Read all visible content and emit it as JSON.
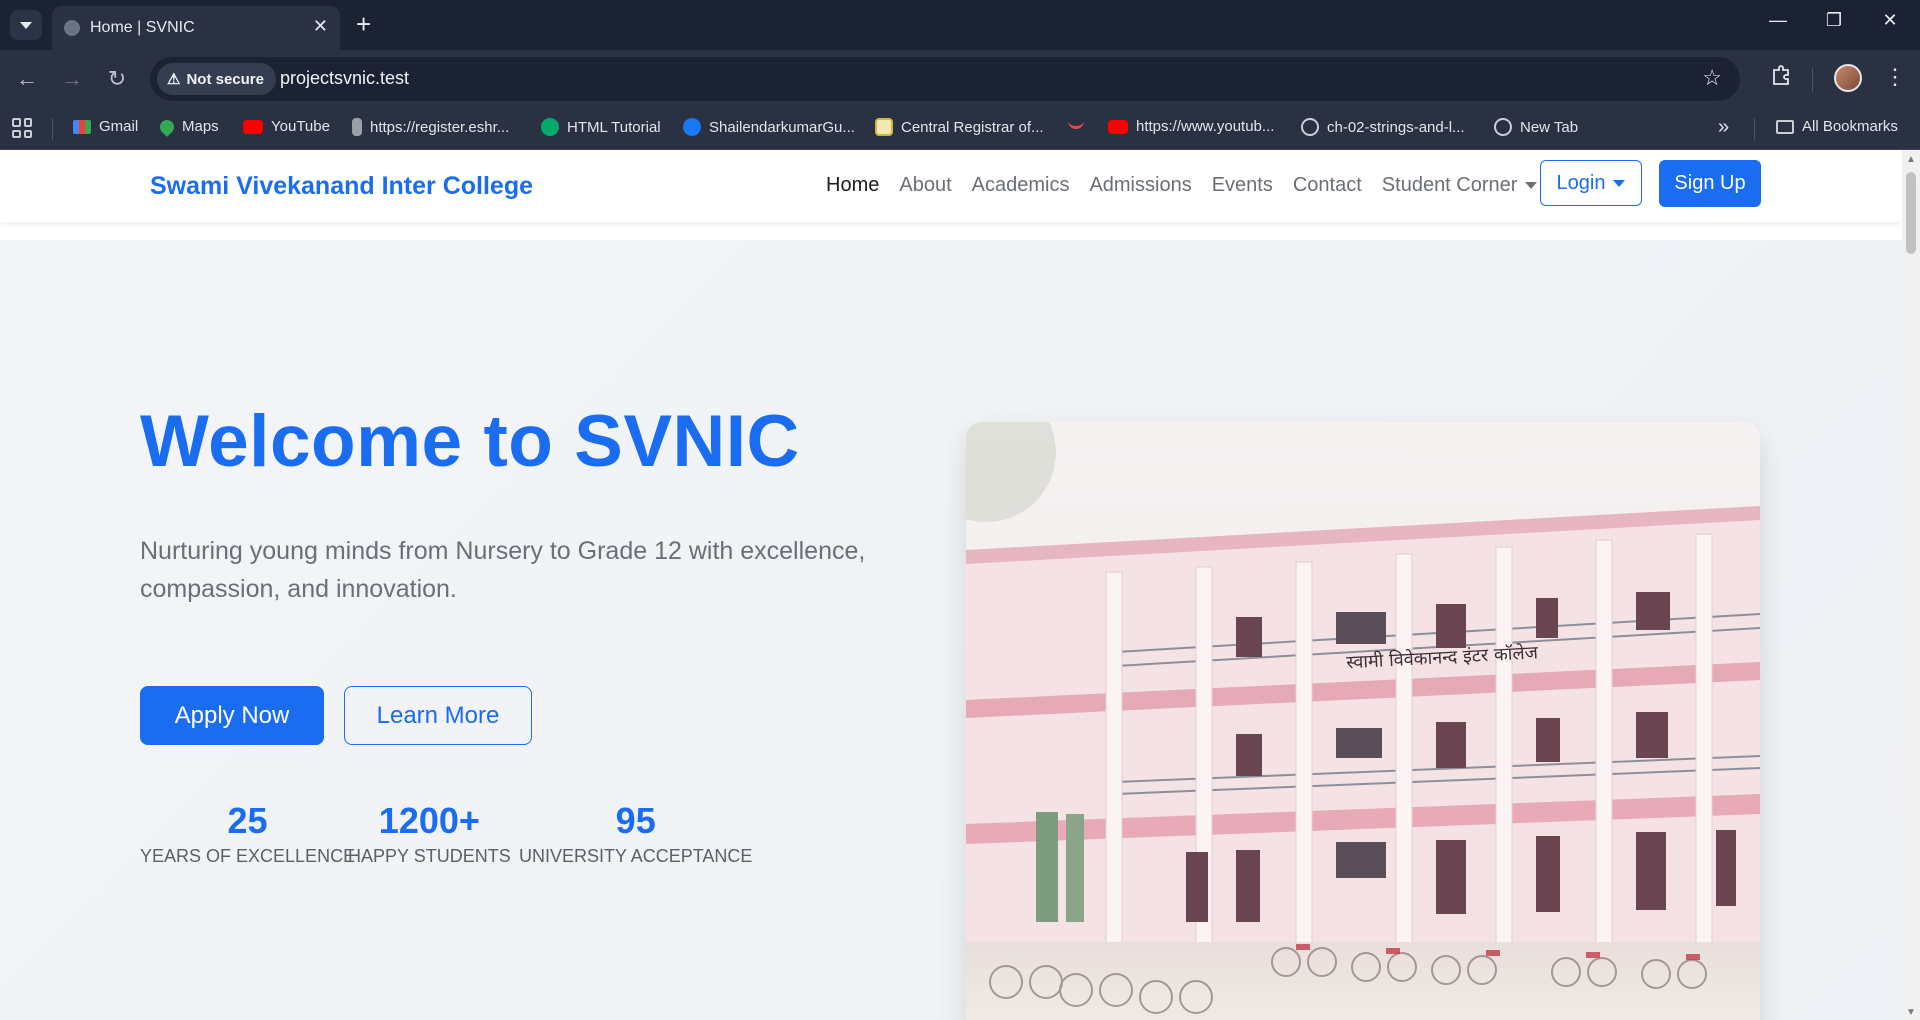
{
  "browser": {
    "tab_title": "Home | SVNIC",
    "security_label": "Not secure",
    "url": "projectsvnic.test",
    "bookmarks": [
      {
        "label": "Gmail",
        "icon": "gmail-icon",
        "color": "#ea4335"
      },
      {
        "label": "Maps",
        "icon": "maps-icon",
        "color": "#34a853"
      },
      {
        "label": "YouTube",
        "icon": "youtube-icon",
        "color": "#ff0000"
      },
      {
        "label": "https://register.eshr...",
        "icon": "emblem-icon",
        "color": "#9aa0a6"
      },
      {
        "label": "HTML Tutorial",
        "icon": "w3-icon",
        "color": "#04aa6d"
      },
      {
        "label": "ShailendarkumarGu...",
        "icon": "facebook-icon",
        "color": "#1877f2"
      },
      {
        "label": "Central Registrar of...",
        "icon": "seal-icon",
        "color": "#d4b43c"
      },
      {
        "label": "",
        "icon": "smile-icon",
        "color": "#e5484d"
      },
      {
        "label": "https://www.youtub...",
        "icon": "youtube-icon",
        "color": "#ff0000"
      },
      {
        "label": "ch-02-strings-and-l...",
        "icon": "globe-icon",
        "color": "#9aa0a6"
      },
      {
        "label": "New Tab",
        "icon": "globe-icon",
        "color": "#9aa0a6"
      }
    ],
    "all_bookmarks_label": "All Bookmarks"
  },
  "site": {
    "brand": "Swami Vivekanand Inter College",
    "nav": {
      "home": "Home",
      "about": "About",
      "academics": "Academics",
      "admissions": "Admissions",
      "events": "Events",
      "contact": "Contact",
      "student_corner": "Student Corner"
    },
    "login_label": "Login",
    "signup_label": "Sign Up",
    "accent_color": "#1a6cf0"
  },
  "hero": {
    "title": "Welcome to SVNIC",
    "subtitle": "Nurturing young minds from Nursery to Grade 12 with excellence, compassion, and innovation.",
    "apply_label": "Apply Now",
    "learn_label": "Learn More",
    "stats": [
      {
        "value": "25",
        "label": "YEARS OF EXCELLENCE"
      },
      {
        "value": "1200+",
        "label": "HAPPY STUDENTS"
      },
      {
        "value": "95",
        "label": "UNIVERSITY ACCEPTANCE"
      }
    ],
    "building_sign": "स्वामी विवेकानन्द इंटर कॉलेज"
  }
}
